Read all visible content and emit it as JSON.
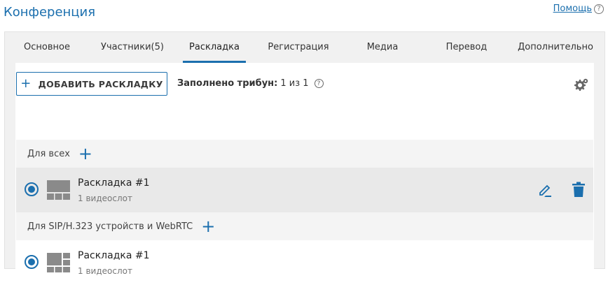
{
  "header": {
    "title": "Конференция",
    "help_label": "Помощь",
    "help_icon": "?"
  },
  "tabs": [
    {
      "label": "Основное"
    },
    {
      "label": "Участники(5)"
    },
    {
      "label": "Раскладка",
      "active": true
    },
    {
      "label": "Регистрация"
    },
    {
      "label": "Медиа"
    },
    {
      "label": "Перевод"
    },
    {
      "label": "Дополнительно"
    }
  ],
  "toolbar": {
    "add_plus": "+",
    "add_label": "ДОБАВИТЬ РАСКЛАДКУ",
    "tribunes_label": "Заполнено трибун:",
    "tribunes_value": "1 из 1",
    "tribunes_help_icon": "?",
    "settings_icon": "gear-icon"
  },
  "groups": [
    {
      "title": "Для всех",
      "add_icon": "+",
      "layouts": [
        {
          "name": "Раскладка #1",
          "subtitle": "1 видеослот",
          "selected": true
        }
      ]
    },
    {
      "title": "Для SIP/H.323 устройств и WebRTC",
      "add_icon": "+",
      "layouts": [
        {
          "name": "Раскладка #1",
          "subtitle": "1 видеослот",
          "selected": true
        }
      ]
    }
  ],
  "colors": {
    "accent": "#1b6fae",
    "panel_bg": "#f1f1f1",
    "row_selected_bg": "#e9e9e9",
    "thumb_gray": "#8a8a8a"
  }
}
